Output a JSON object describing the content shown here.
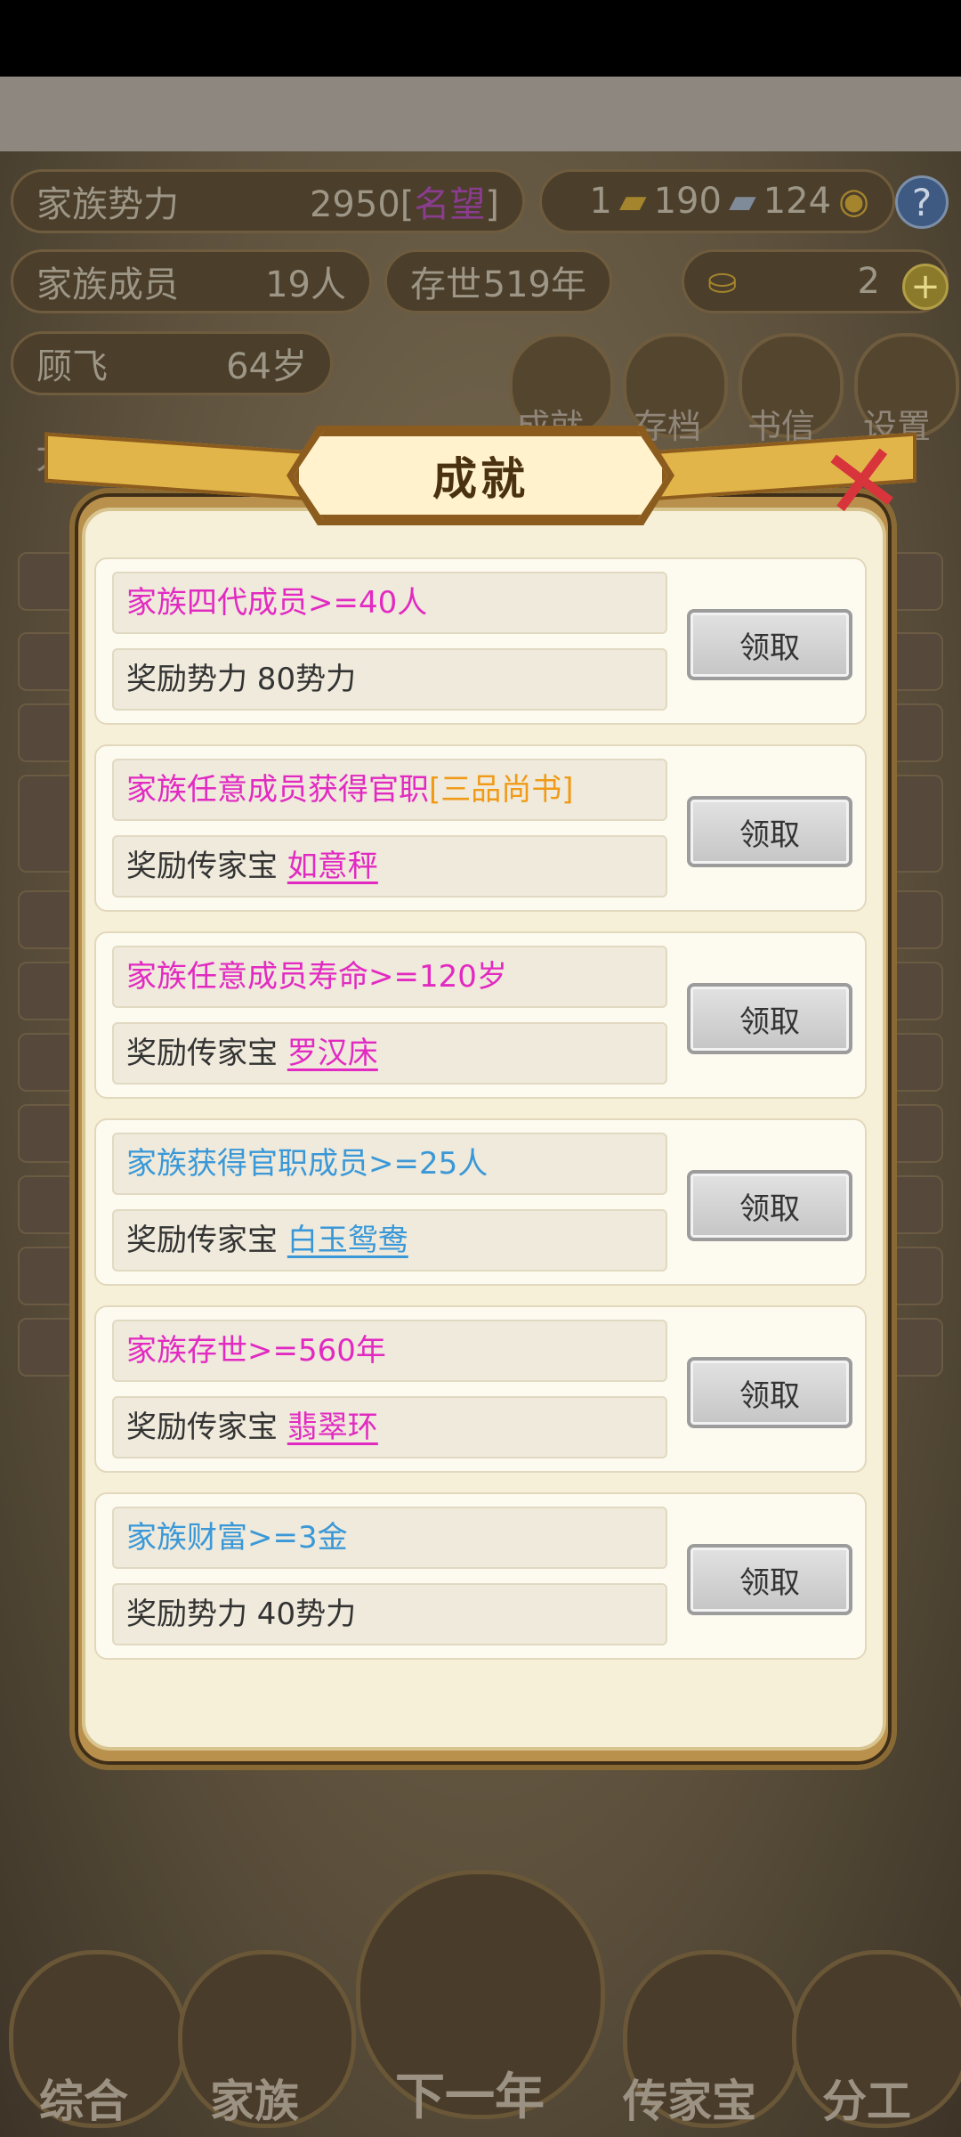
{
  "background": {
    "stats": {
      "power_label": "家族势力",
      "power_value": "2950",
      "power_bracket_open": "[",
      "power_rank": "名望",
      "power_bracket_close": "]",
      "gold_count": "1",
      "silver_count": "190",
      "coin_count": "124",
      "help_symbol": "?",
      "members_label": "家族成员",
      "members_value": "19人",
      "years_label": "存世",
      "years_value": "519年",
      "ingot_count": "2",
      "plus_symbol": "+",
      "head_name": "顾飞",
      "head_age": "64岁"
    },
    "top_icons": [
      "成就",
      "存档",
      "书信",
      "设置"
    ],
    "log_title": "大事记",
    "bottom_nav": [
      "综合",
      "家族",
      "下一年",
      "传家宝",
      "分工"
    ]
  },
  "modal": {
    "title": "成就",
    "close_symbol": "✕",
    "accent_colors": {
      "pink": "#e22ac2",
      "blue": "#3a98d8",
      "orange": "#f09a18"
    },
    "achievements": [
      {
        "condition": "家族四代成员>=40人",
        "condition_color": "pink",
        "reward_prefix": "奖励势力 80势力",
        "reward_item": "",
        "button": "领取"
      },
      {
        "condition": "家族任意成员获得官职",
        "condition_suffix": "[三品尚书]",
        "condition_color": "pink",
        "reward_prefix": "奖励传家宝 ",
        "reward_item": "如意秤",
        "reward_item_color": "pink",
        "button": "领取"
      },
      {
        "condition": "家族任意成员寿命>=120岁",
        "condition_color": "pink",
        "reward_prefix": "奖励传家宝 ",
        "reward_item": "罗汉床",
        "reward_item_color": "pink",
        "button": "领取"
      },
      {
        "condition": "家族获得官职成员>=25人",
        "condition_color": "blue",
        "reward_prefix": "奖励传家宝 ",
        "reward_item": "白玉鸳鸯",
        "reward_item_color": "blue",
        "button": "领取"
      },
      {
        "condition": "家族存世>=560年",
        "condition_color": "pink",
        "reward_prefix": "奖励传家宝 ",
        "reward_item": "翡翠环",
        "reward_item_color": "pink",
        "button": "领取"
      },
      {
        "condition": "家族财富>=3金",
        "condition_color": "blue",
        "reward_prefix": "奖励势力 40势力",
        "reward_item": "",
        "button": "领取"
      }
    ]
  }
}
